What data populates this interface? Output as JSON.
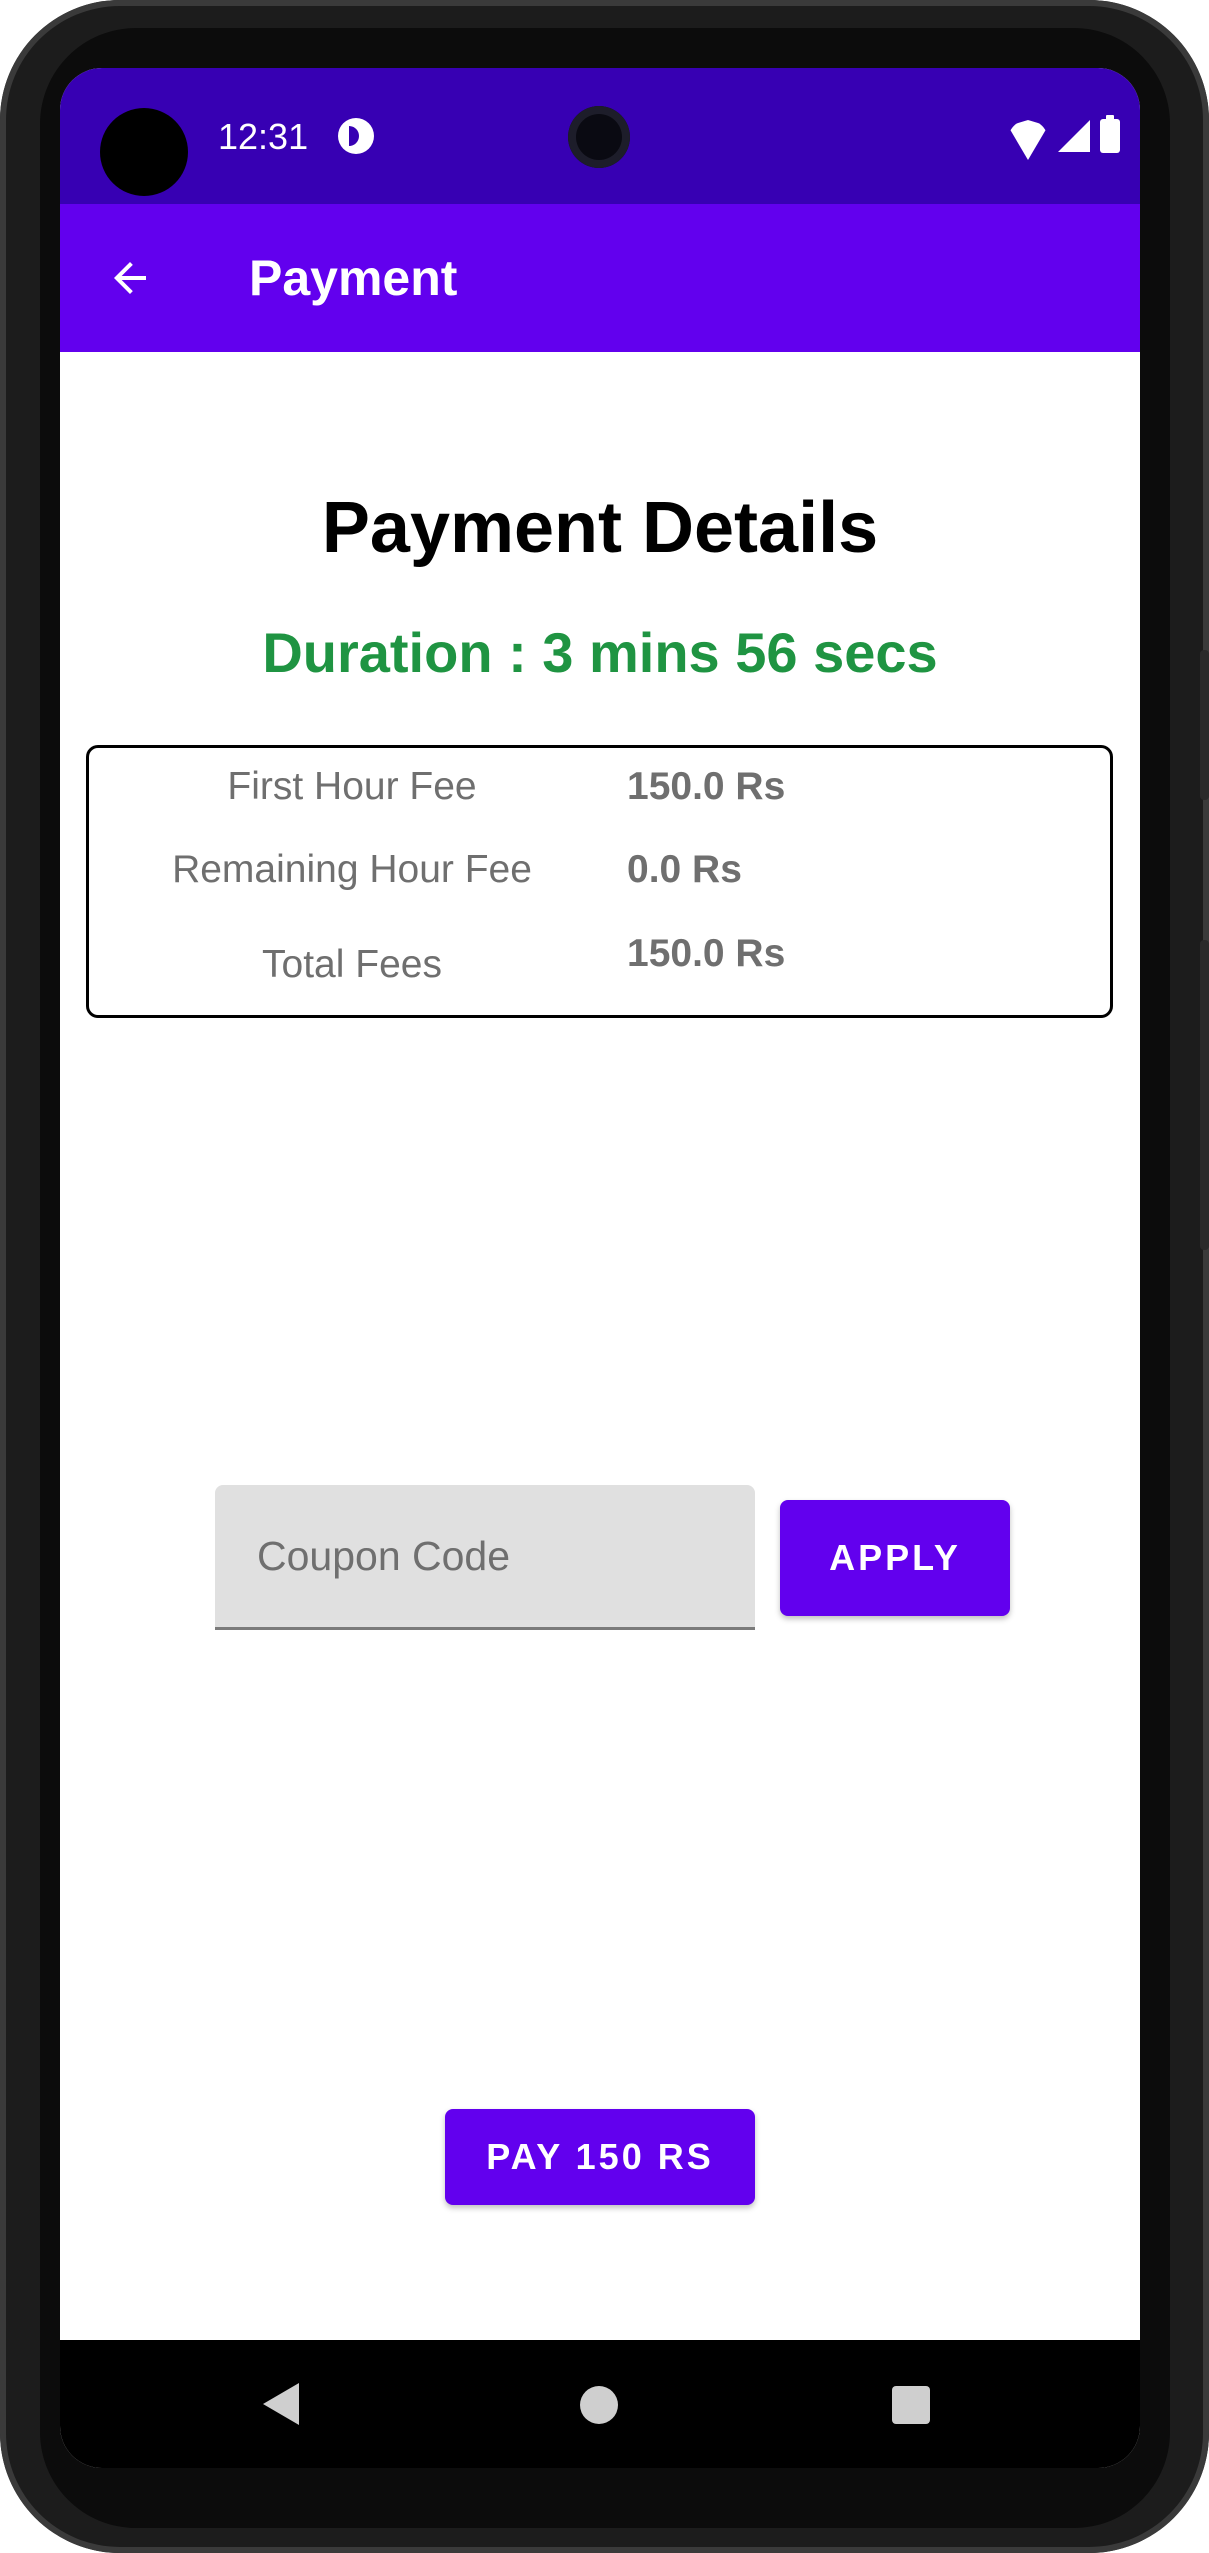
{
  "status_bar": {
    "time": "12:31",
    "icons": [
      "app-notification-icon",
      "wifi-icon",
      "signal-icon",
      "battery-icon"
    ]
  },
  "app_bar": {
    "title": "Payment",
    "back_icon": "arrow-back-icon"
  },
  "main": {
    "title": "Payment Details",
    "duration": "Duration : 3 mins 56 secs",
    "fees": [
      {
        "label": "First Hour Fee",
        "value": "150.0 Rs"
      },
      {
        "label": "Remaining Hour Fee",
        "value": "0.0 Rs"
      },
      {
        "label": "Total Fees",
        "value": "150.0 Rs"
      }
    ],
    "coupon": {
      "placeholder": "Coupon Code",
      "value": ""
    },
    "apply_label": "APPLY",
    "pay_label": "PAY 150 RS"
  },
  "nav_bar": {
    "icons": [
      "nav-back-icon",
      "nav-home-icon",
      "nav-recents-icon"
    ]
  },
  "colors": {
    "status_bar": "#3700b3",
    "primary": "#6200ee",
    "duration_text": "#1f9442",
    "fee_text": "#6f6f6f",
    "coupon_field": "#e0e0e0"
  }
}
